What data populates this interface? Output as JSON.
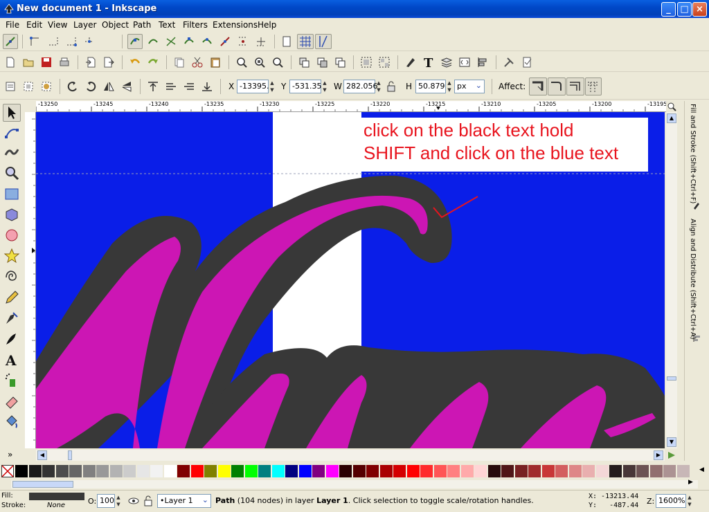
{
  "window": {
    "title": "New document 1 - Inkscape",
    "min_label": "_",
    "max_label": "□",
    "close_label": "×"
  },
  "menu": [
    "File",
    "Edit",
    "View",
    "Layer",
    "Object",
    "Path",
    "Text",
    "Filters",
    "Extensions",
    "Help"
  ],
  "select_toolbar": {
    "x_label": "X",
    "x_value": "-13395.",
    "y_label": "Y",
    "y_value": "-531.35",
    "w_label": "W",
    "w_value": "282.056",
    "h_label": "H",
    "h_value": "50.879",
    "unit": "px",
    "affect_label": "Affect:"
  },
  "ruler_labels": [
    "-13250",
    "-13245",
    "-13240",
    "-13235",
    "-13230",
    "-13225",
    "-13220",
    "-13215",
    "-13210",
    "-13205",
    "-13200",
    "-13195"
  ],
  "canvas": {
    "instruction_line1": "click on the black text hold",
    "instruction_line2": "SHIFT and click on the blue text",
    "colors": {
      "background": "#0a1ee8",
      "white_band": "#ffffff",
      "outline": "#383838",
      "fill": "#cc16b4",
      "annotation": "#e8141e"
    }
  },
  "dock": {
    "tab1": "Fill and Stroke (Shift+Ctrl+F)",
    "tab2": "Align and Distribute (Shift+Ctrl+A)"
  },
  "palette_colors": [
    "#000000",
    "#1a1a1a",
    "#333333",
    "#4d4d4d",
    "#666666",
    "#808080",
    "#999999",
    "#b3b3b3",
    "#cccccc",
    "#e6e6e6",
    "#f2f2f2",
    "#ffffff",
    "#800000",
    "#ff0000",
    "#808000",
    "#ffff00",
    "#008000",
    "#00ff00",
    "#008080",
    "#00ffff",
    "#000080",
    "#0000ff",
    "#800080",
    "#ff00ff",
    "#2b0000",
    "#550000",
    "#800000",
    "#aa0000",
    "#d40000",
    "#ff0000",
    "#ff2a2a",
    "#ff5555",
    "#ff8080",
    "#ffaaaa",
    "#ffd5d5",
    "#280b0b",
    "#501616",
    "#782121",
    "#a02c2c",
    "#c83737",
    "#d35f5f",
    "#de8787",
    "#e9afaf",
    "#f4d7d7",
    "#241c1c",
    "#483737",
    "#6c5353",
    "#916f6f",
    "#ac9393",
    "#c8b7b7"
  ],
  "status": {
    "fill_label": "Fill:",
    "stroke_label": "Stroke:",
    "stroke_value": "None",
    "opacity_label": "O:",
    "opacity_value": "100",
    "layer": "•Layer 1",
    "message_prefix": "Path",
    "message_rest": " (104 nodes) in layer ",
    "message_layer": "Layer 1",
    "message_suffix": ". Click selection to toggle scale/rotation handles.",
    "coord_x": "X: -13213.44",
    "coord_y": "Y:   -487.44",
    "zoom_label": "Z:",
    "zoom_value": "1600%"
  }
}
